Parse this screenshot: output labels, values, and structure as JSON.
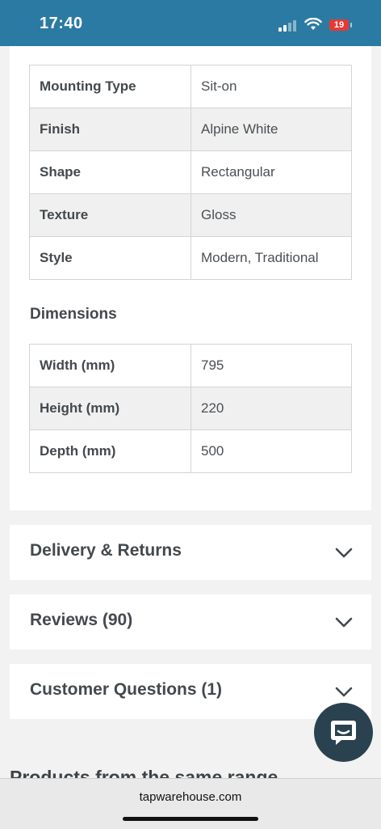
{
  "status_bar": {
    "time": "17:40",
    "battery": "19",
    "signal_bars_active": 2,
    "signal_bars_total": 4
  },
  "specs": [
    {
      "label": "Mounting Type",
      "value": "Sit-on"
    },
    {
      "label": "Finish",
      "value": "Alpine White"
    },
    {
      "label": "Shape",
      "value": "Rectangular"
    },
    {
      "label": "Texture",
      "value": "Gloss"
    },
    {
      "label": "Style",
      "value": "Modern, Traditional"
    }
  ],
  "dimensions": {
    "title": "Dimensions",
    "rows": [
      {
        "label": "Width (mm)",
        "value": "795"
      },
      {
        "label": "Height (mm)",
        "value": "220"
      },
      {
        "label": "Depth (mm)",
        "value": "500"
      }
    ]
  },
  "accordions": [
    {
      "title": "Delivery & Returns"
    },
    {
      "title": "Reviews (90)"
    },
    {
      "title": "Customer Questions (1)"
    }
  ],
  "range_heading": "Products from the same range",
  "browser": {
    "url": "tapwarehouse.com"
  },
  "colors": {
    "status_bar": "#2b7aa3",
    "chat_button": "#2a4250",
    "battery": "#e53935"
  },
  "icons": {
    "chat": "chat-bubble-icon",
    "chevron": "chevron-down-icon",
    "wifi": "wifi-icon",
    "signal": "signal-icon"
  }
}
